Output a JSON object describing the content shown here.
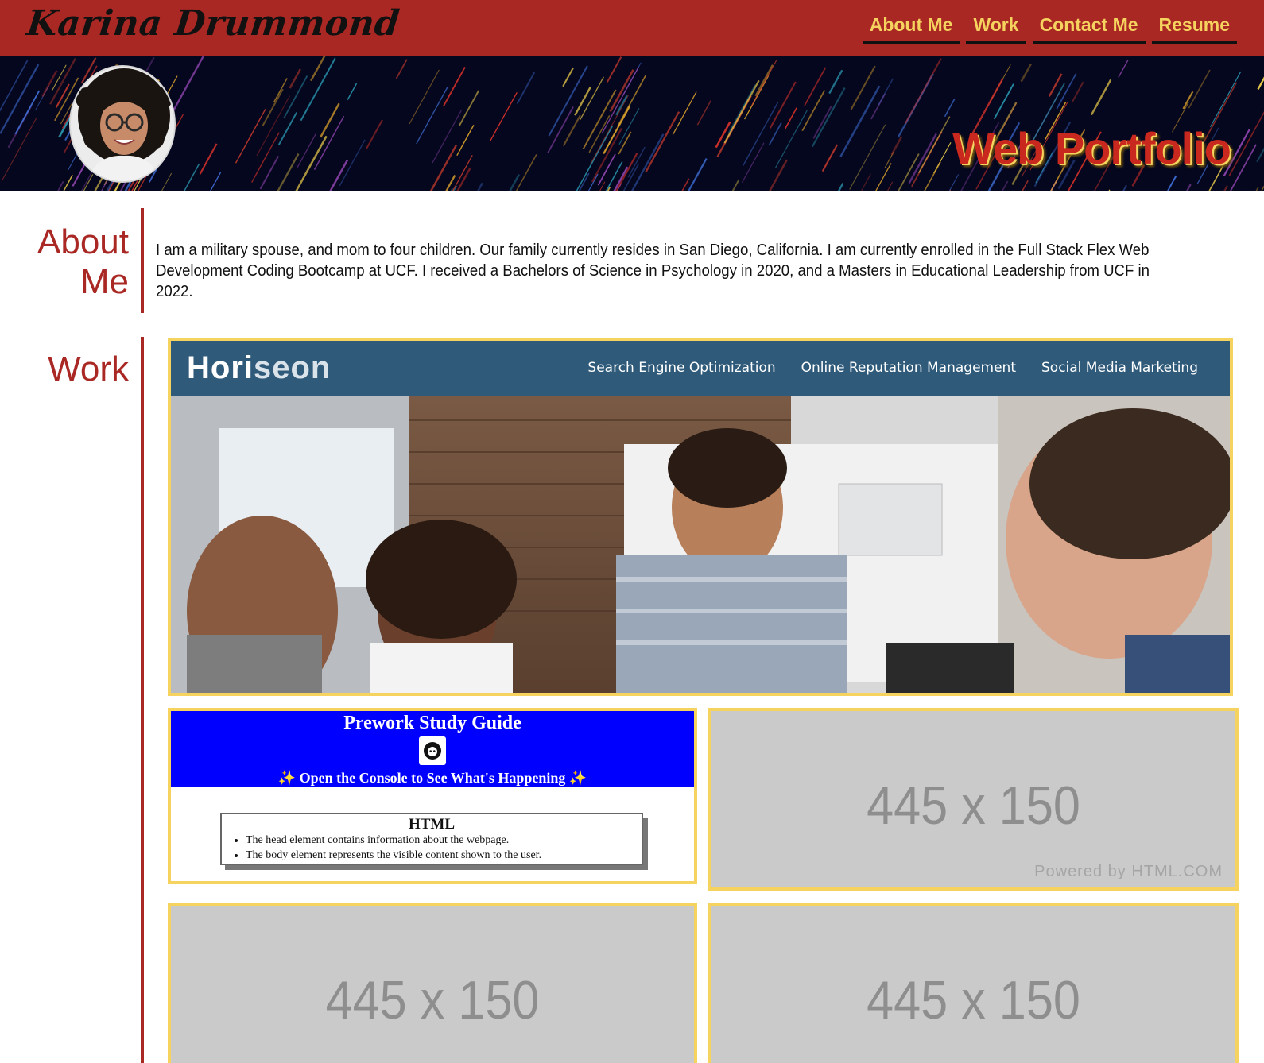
{
  "header": {
    "brand": "Karina Drummond",
    "nav": [
      "About Me",
      "Work",
      "Contact Me",
      "Resume"
    ]
  },
  "hero": {
    "title": "Web Portfolio"
  },
  "about": {
    "heading_line1": "About",
    "heading_line2": "Me",
    "text": "I am a military spouse, and mom to four children. Our family currently resides in San Diego, California. I am currently enrolled in the Full Stack Flex Web Development Coding Bootcamp at UCF. I received a Bachelors of Science in Psychology in 2020, and a Masters in Educational Leadership from UCF in 2022."
  },
  "work": {
    "heading": "Work",
    "horiseon": {
      "logo_a": "Hori",
      "logo_b": "seon",
      "nav": [
        "Search Engine Optimization",
        "Online Reputation Management",
        "Social Media Marketing"
      ]
    },
    "prework": {
      "title": "Prework Study Guide",
      "subtitle_star_left": "✨",
      "subtitle": " Open the Console to See What's Happening ",
      "subtitle_star_right": "✨",
      "box_title": "HTML",
      "bullets": [
        "The head element contains information about the webpage.",
        "The body element represents the visible content shown to the user."
      ]
    },
    "placeholders": [
      {
        "label": "445 x 150",
        "powered": "Powered by HTML.COM"
      },
      {
        "label": "445 x 150"
      },
      {
        "label": "445 x 150"
      }
    ]
  },
  "colors": {
    "primary": "#aa2824",
    "accent": "#f6d35f",
    "hero_bg": "#05071e",
    "horiseon_header": "#2f5a7a",
    "prework_blue": "#0000fe",
    "placeholder_gray": "#cacaca"
  }
}
